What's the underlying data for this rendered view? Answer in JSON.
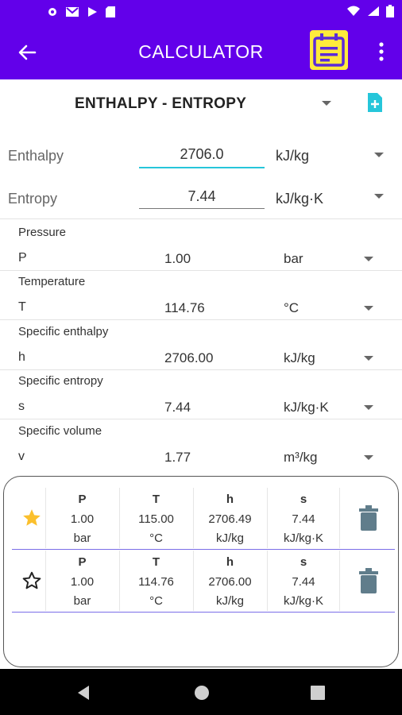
{
  "colors": {
    "primary": "#6200ea",
    "accent": "#ffeb3b",
    "teal": "#26c6da",
    "star": "#fbc02d",
    "trash": "#607d8b"
  },
  "statusbar": {
    "icons": [
      "gear-icon",
      "mail-icon",
      "play-icon",
      "sdcard-icon"
    ],
    "right_icons": [
      "wifi-icon",
      "signal-icon",
      "battery-icon"
    ]
  },
  "appbar": {
    "title": "CALCULATOR",
    "back_icon": "arrow-left-icon",
    "calendar_icon": "calendar-icon",
    "more_icon": "more-vert-icon"
  },
  "mode": {
    "label": "ENTHALPY - ENTROPY",
    "add_icon": "add-file-icon"
  },
  "inputs": [
    {
      "label": "Enthalpy",
      "value": "2706.0",
      "unit": "kJ/kg"
    },
    {
      "label": "Entropy",
      "value": "7.44",
      "unit": "kJ/kg·K"
    }
  ],
  "results": [
    {
      "title": "Pressure",
      "symbol": "P",
      "value": "1.00",
      "unit": "bar"
    },
    {
      "title": "Temperature",
      "symbol": "T",
      "value": "114.76",
      "unit": "°C"
    },
    {
      "title": "Specific enthalpy",
      "symbol": "h",
      "value": "2706.00",
      "unit": "kJ/kg"
    },
    {
      "title": "Specific entropy",
      "symbol": "s",
      "value": "7.44",
      "unit": "kJ/kg·K"
    },
    {
      "title": "Specific volume",
      "symbol": "v",
      "value": "1.77",
      "unit": "m³/kg"
    }
  ],
  "history": [
    {
      "starred": true,
      "cells": [
        {
          "h": "P",
          "v": "1.00",
          "u": "bar"
        },
        {
          "h": "T",
          "v": "115.00",
          "u": "°C"
        },
        {
          "h": "h",
          "v": "2706.49",
          "u": "kJ/kg"
        },
        {
          "h": "s",
          "v": "7.44",
          "u": "kJ/kg·K"
        }
      ]
    },
    {
      "starred": false,
      "cells": [
        {
          "h": "P",
          "v": "1.00",
          "u": "bar"
        },
        {
          "h": "T",
          "v": "114.76",
          "u": "°C"
        },
        {
          "h": "h",
          "v": "2706.00",
          "u": "kJ/kg"
        },
        {
          "h": "s",
          "v": "7.44",
          "u": "kJ/kg·K"
        }
      ]
    }
  ],
  "navbar": {
    "icons": [
      "back-triangle-icon",
      "home-circle-icon",
      "recents-square-icon"
    ]
  }
}
